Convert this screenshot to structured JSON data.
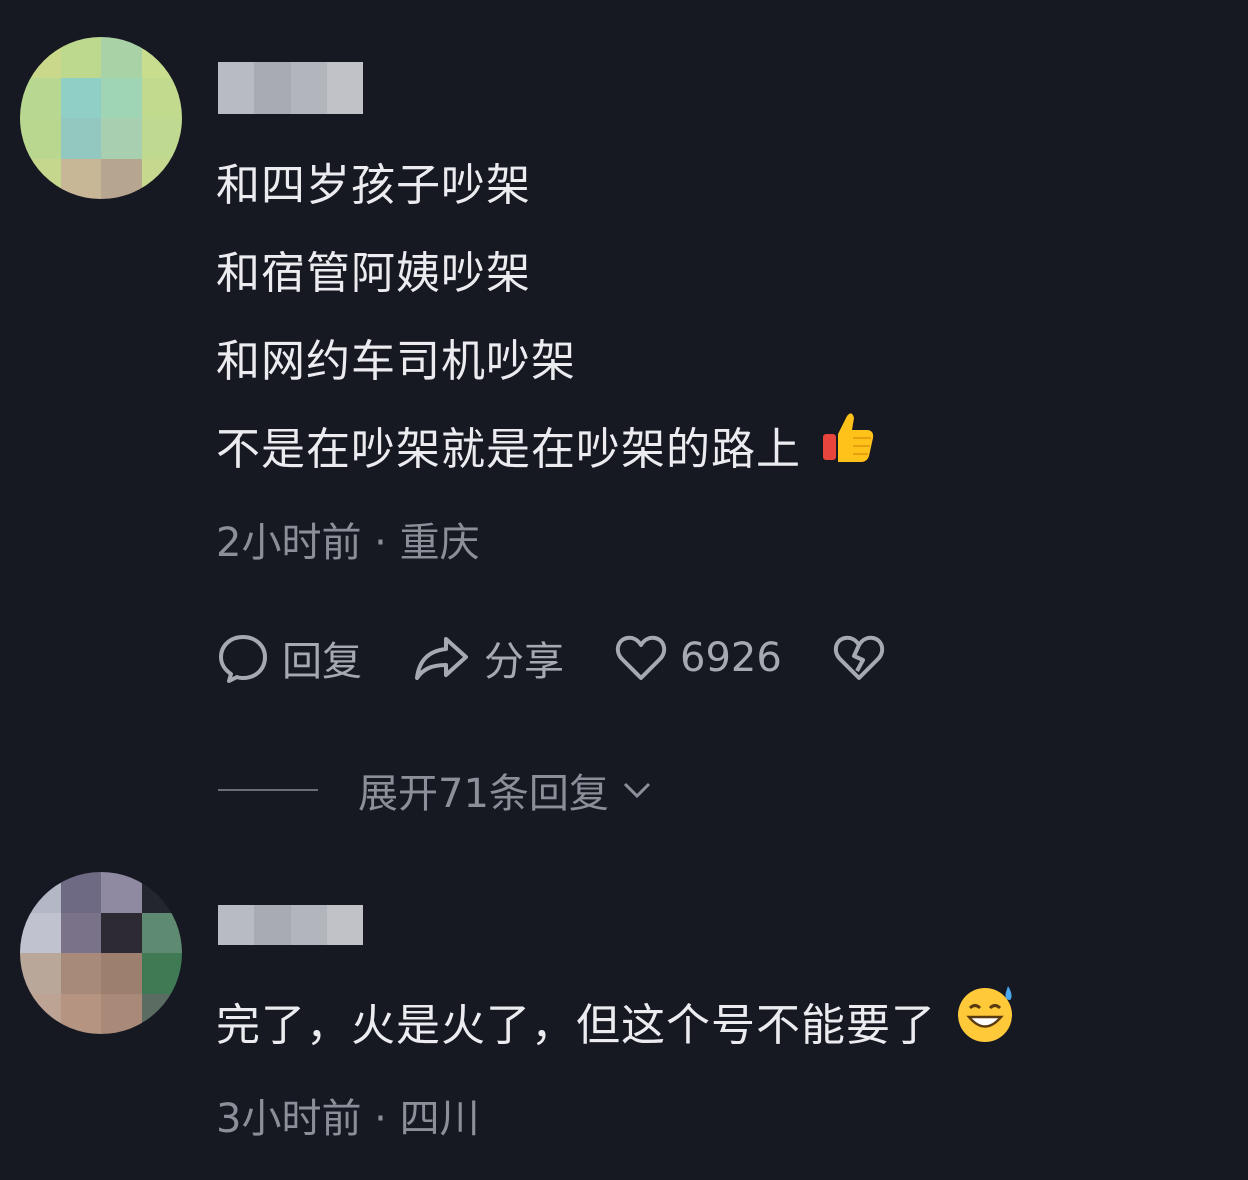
{
  "comments": [
    {
      "lines": [
        "和四岁孩子吵架",
        "和宿管阿姨吵架",
        "和网约车司机吵架",
        "不是在吵架就是在吵架的路上"
      ],
      "trailing_emoji": "thumbs-up-icon",
      "time": "2小时前",
      "location": "重庆",
      "actions": {
        "reply": "回复",
        "share": "分享",
        "likes": "6926"
      },
      "expand": "展开71条回复"
    },
    {
      "lines": [
        "完了，火是火了，但这个号不能要了"
      ],
      "trailing_emoji": "grinning-sweat-icon",
      "time": "3小时前",
      "location": "四川"
    }
  ],
  "meta_separator": "·",
  "colors": {
    "background": "#161822",
    "text": "#ececf0",
    "muted": "#8c8e98"
  }
}
